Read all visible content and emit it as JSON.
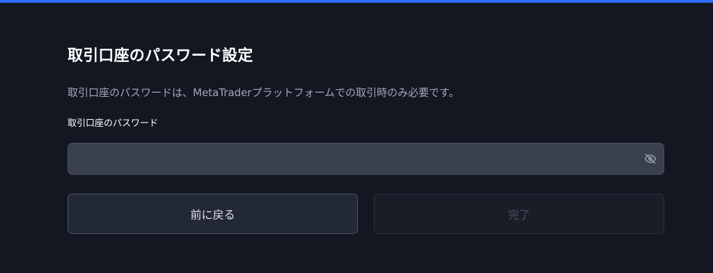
{
  "colors": {
    "accent": "#2f6bff",
    "background": "#131722",
    "input_background": "#3a3f4d",
    "disabled_text": "#4a4f5c"
  },
  "form": {
    "title": "取引口座のパスワード設定",
    "description": "取引口座のパスワードは、MetaTraderプラットフォームでの取引時のみ必要です。",
    "password_label": "取引口座のパスワード",
    "password_value": "",
    "password_placeholder": "",
    "visibility_icon": "eye-off-icon"
  },
  "buttons": {
    "back_label": "前に戻る",
    "done_label": "完了",
    "done_disabled": true
  }
}
